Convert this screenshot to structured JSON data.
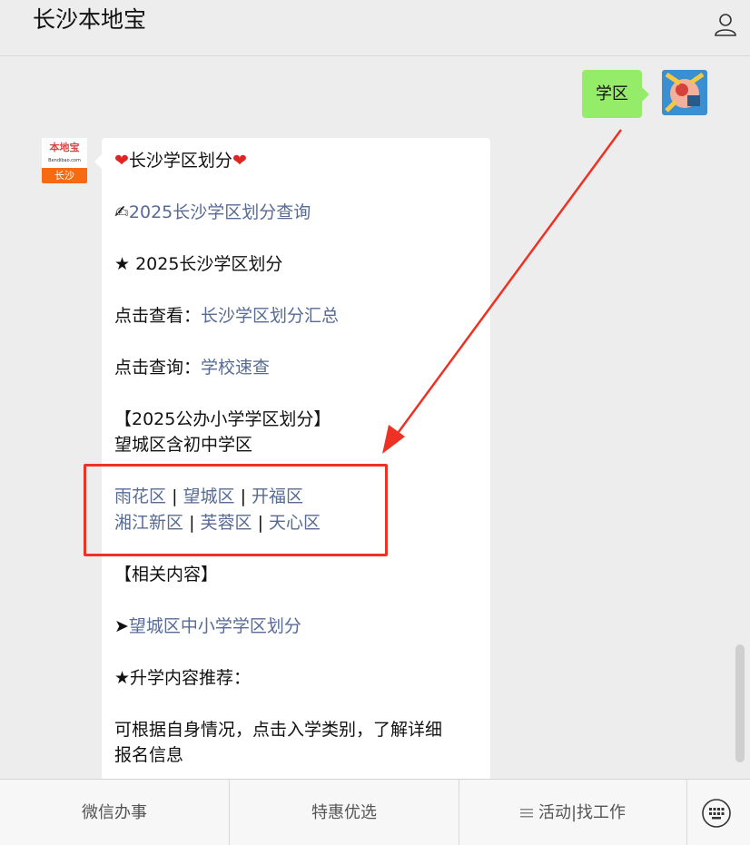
{
  "header": {
    "title": "长沙本地宝",
    "profile_icon": "person-icon"
  },
  "user_message": {
    "text": "学区"
  },
  "bot_avatar": {
    "logo_text": "本地宝",
    "logo_sub": "Bendibao.com",
    "city": "长沙"
  },
  "bot_message": {
    "heading": "长沙学区划分",
    "query_link": "2025长沙学区划分查询",
    "section_title": "★ 2025长沙学区划分",
    "view_prefix": "点击查看：",
    "view_link": "长沙学区划分汇总",
    "query_prefix": "点击查询：",
    "school_link": "学校速查",
    "public_title": "【2025公办小学学区划分】",
    "wangcheng_note": "望城区含初中学区",
    "districts_row1": [
      "雨花区",
      "望城区",
      "开福区"
    ],
    "districts_row2": [
      "湘江新区",
      "芙蓉区",
      "天心区"
    ],
    "separator": "|",
    "related_title": "【相关内容】",
    "related_arrow": "➤",
    "related_link": "望城区中小学学区划分",
    "recommend_title": "★升学内容推荐：",
    "recommend_text_1": "可根据自身情况，点击入学类别，了解详细",
    "recommend_text_2": "报名信息"
  },
  "bottom_menu": {
    "item1": "微信办事",
    "item2": "特惠优选",
    "item3": "活动|找工作",
    "keyboard_icon": "keyboard-icon"
  },
  "colors": {
    "link": "#576b95",
    "user_bubble": "#95ec69",
    "annotation": "#ee3124"
  }
}
